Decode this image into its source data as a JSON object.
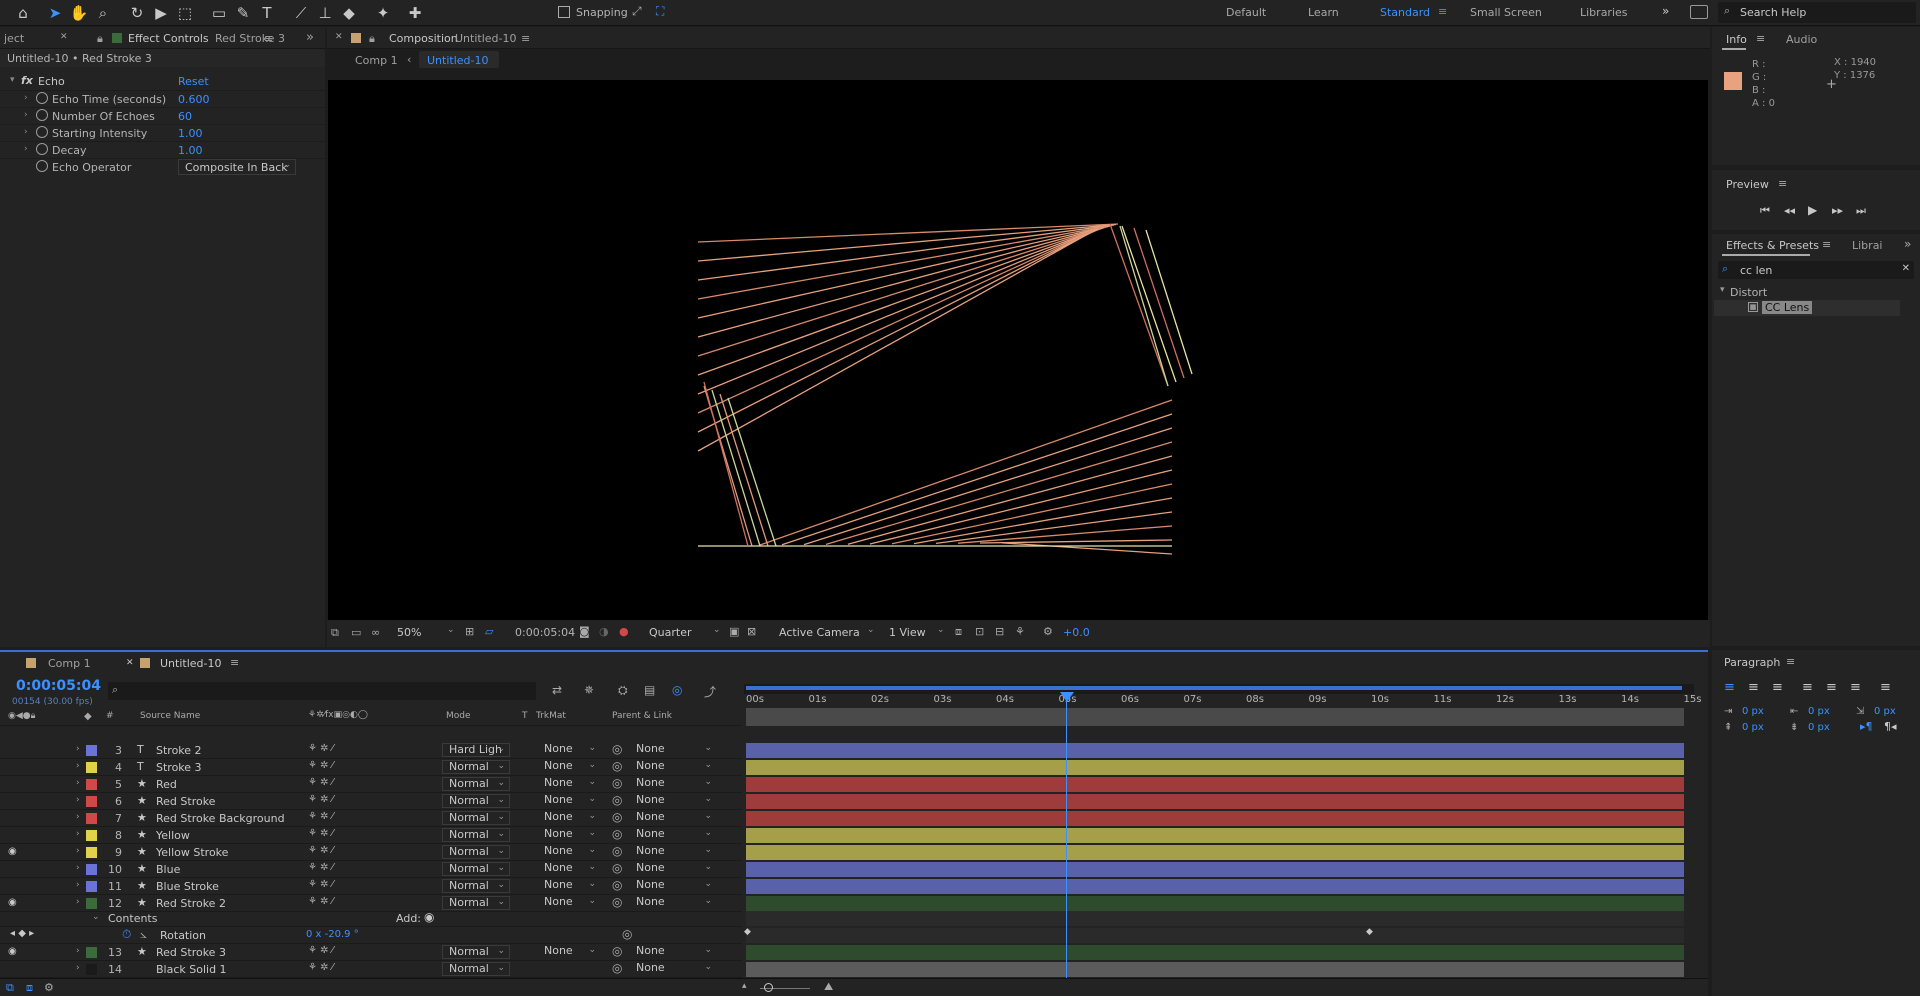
{
  "toolbar": {
    "snapping_label": "Snapping",
    "workspaces": [
      "Default",
      "Learn",
      "Standard",
      "Small Screen",
      "Libraries"
    ],
    "active_workspace": "Standard",
    "search_placeholder": "Search Help"
  },
  "effect_controls": {
    "tab_project": "ject",
    "tab_label": "Effect Controls",
    "tab_layer": "Red Stroke 3",
    "subtitle": "Untitled-10 • Red Stroke 3",
    "effect_name": "Echo",
    "reset_label": "Reset",
    "properties": [
      {
        "name": "Echo Time (seconds)",
        "value": "0.600"
      },
      {
        "name": "Number Of Echoes",
        "value": "60"
      },
      {
        "name": "Starting Intensity",
        "value": "1.00"
      },
      {
        "name": "Decay",
        "value": "1.00"
      },
      {
        "name": "Echo Operator",
        "value": "Composite In Back"
      }
    ]
  },
  "composition": {
    "tab_label": "Composition",
    "tab_name": "Untitled-10",
    "crumbs": [
      "Comp 1",
      "Untitled-10"
    ],
    "zoom": "50%",
    "timecode": "0:00:05:04",
    "resolution": "Quarter",
    "camera": "Active Camera",
    "view": "1 View",
    "exposure": "+0.0"
  },
  "info": {
    "tab_info": "Info",
    "tab_audio": "Audio",
    "r": "R :",
    "g": "G :",
    "b": "B :",
    "a": "A :  0",
    "x": "X : 1940",
    "y": "Y : 1376",
    "swatch": "#e9a27f"
  },
  "preview": {
    "title": "Preview"
  },
  "effects_presets": {
    "title": "Effects & Presets",
    "libraries_tab": "Librai",
    "search_value": "cc len",
    "category": "Distort",
    "item": "CC Lens"
  },
  "paragraph": {
    "title": "Paragraph",
    "values": [
      "0 px",
      "0 px",
      "0 px",
      "0 px",
      "0 px"
    ]
  },
  "timeline": {
    "tabs": [
      "Comp 1",
      "Untitled-10"
    ],
    "timecode": "0:00:05:04",
    "frames_info": "00154 (30.00 fps)",
    "columns": {
      "source_name": "Source Name",
      "mode": "Mode",
      "t": "T",
      "trkmat": "TrkMat",
      "parent": "Parent & Link"
    },
    "ruler": [
      "00s",
      "01s",
      "02s",
      "03s",
      "04s",
      "05s",
      "06s",
      "07s",
      "08s",
      "09s",
      "10s",
      "11s",
      "12s",
      "13s",
      "14s",
      "15s"
    ],
    "layers": [
      {
        "num": "3",
        "type": "T",
        "name": "Stroke 2",
        "mode": "Hard Ligh",
        "trk": "None",
        "parent": "None",
        "color": "#6b74d6",
        "bar": "#5961ab",
        "eye": false
      },
      {
        "num": "4",
        "type": "T",
        "name": "Stroke 3",
        "mode": "Normal",
        "trk": "None",
        "parent": "None",
        "color": "#e0d24a",
        "bar": "#a49f48",
        "eye": false
      },
      {
        "num": "5",
        "type": "★",
        "name": "Red",
        "mode": "Normal",
        "trk": "None",
        "parent": "None",
        "color": "#d04848",
        "bar": "#9e3c3c",
        "eye": false
      },
      {
        "num": "6",
        "type": "★",
        "name": "Red Stroke",
        "mode": "Normal",
        "trk": "None",
        "parent": "None",
        "color": "#d04848",
        "bar": "#9e3c3c",
        "eye": false
      },
      {
        "num": "7",
        "type": "★",
        "name": "Red Stroke Background",
        "mode": "Normal",
        "trk": "None",
        "parent": "None",
        "color": "#d04848",
        "bar": "#9e3c3c",
        "eye": false
      },
      {
        "num": "8",
        "type": "★",
        "name": "Yellow",
        "mode": "Normal",
        "trk": "None",
        "parent": "None",
        "color": "#e0d24a",
        "bar": "#a49f48",
        "eye": false
      },
      {
        "num": "9",
        "type": "★",
        "name": "Yellow Stroke",
        "mode": "Normal",
        "trk": "None",
        "parent": "None",
        "color": "#e0d24a",
        "bar": "#a49f48",
        "eye": true
      },
      {
        "num": "10",
        "type": "★",
        "name": "Blue",
        "mode": "Normal",
        "trk": "None",
        "parent": "None",
        "color": "#6b74d6",
        "bar": "#5961ab",
        "eye": false
      },
      {
        "num": "11",
        "type": "★",
        "name": "Blue Stroke",
        "mode": "Normal",
        "trk": "None",
        "parent": "None",
        "color": "#6b74d6",
        "bar": "#5961ab",
        "eye": false
      },
      {
        "num": "12",
        "type": "★",
        "name": "Red Stroke 2",
        "mode": "Normal",
        "trk": "None",
        "parent": "None",
        "color": "#3b6b3b",
        "bar": "#2e4b2e",
        "eye": true
      }
    ],
    "contents_label": "Contents",
    "add_label": "Add:",
    "rotation_label": "Rotation",
    "rotation_value": "0 x -20.9 °",
    "layers_bottom": [
      {
        "num": "13",
        "type": "★",
        "name": "Red Stroke 3",
        "mode": "Normal",
        "trk": "None",
        "parent": "None",
        "color": "#3b6b3b",
        "bar": "#2e4b2e",
        "eye": true
      },
      {
        "num": "14",
        "type": "",
        "name": "Black Solid 1",
        "mode": "Normal",
        "trk": "",
        "parent": "None",
        "color": "#1a1a1a",
        "bar": "#5b5b5b",
        "eye": false
      }
    ]
  }
}
